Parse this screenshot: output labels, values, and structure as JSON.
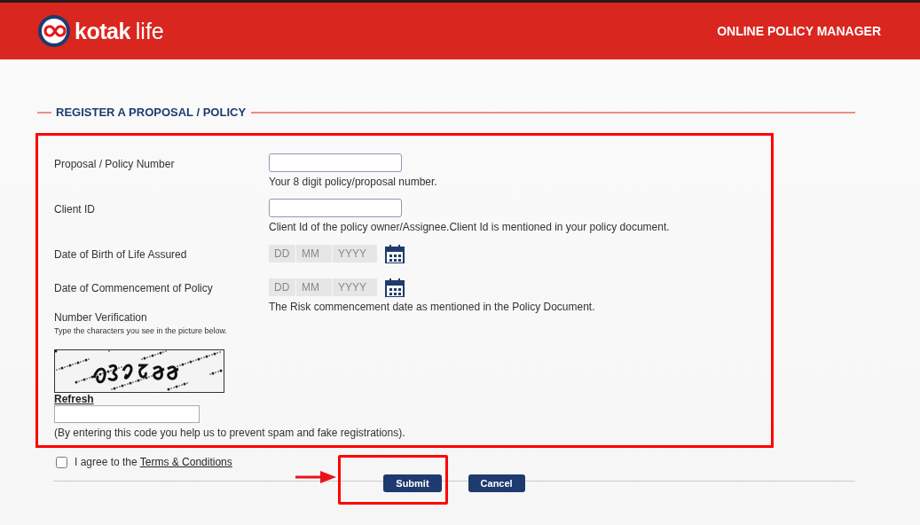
{
  "header": {
    "logo": {
      "brand": "kotak",
      "suffix": "life"
    },
    "title": "ONLINE POLICY MANAGER"
  },
  "section_title": "REGISTER A PROPOSAL / POLICY",
  "form": {
    "highlighted": true,
    "fields": [
      {
        "kind": "text",
        "label": "Proposal / Policy Number",
        "hint": "Your 8 digit policy/proposal number."
      },
      {
        "kind": "text",
        "label": "Client ID",
        "hint": "Client Id of the policy owner/Assignee.Client Id is mentioned in your policy document."
      },
      {
        "kind": "date",
        "label": "Date of Birth of Life Assured",
        "placeholders": [
          "DD",
          "MM",
          "YYYY"
        ]
      },
      {
        "kind": "date",
        "label": "Date of Commencement of Policy",
        "placeholders": [
          "DD",
          "MM",
          "YYYY"
        ],
        "hint": "The Risk commencement date as mentioned in the Policy Document."
      }
    ],
    "verification": {
      "label": "Number Verification",
      "instruction": "Type the characters you see in the picture below.",
      "refresh": "Refresh",
      "note": "(By entering this code you help us to prevent spam and fake registrations)."
    }
  },
  "agree": {
    "checked": false,
    "text": "I agree to the",
    "link": "Terms & Conditions"
  },
  "buttons": [
    {
      "label": "Submit",
      "highlighted": true
    },
    {
      "label": "Cancel",
      "highlighted": false
    }
  ]
}
